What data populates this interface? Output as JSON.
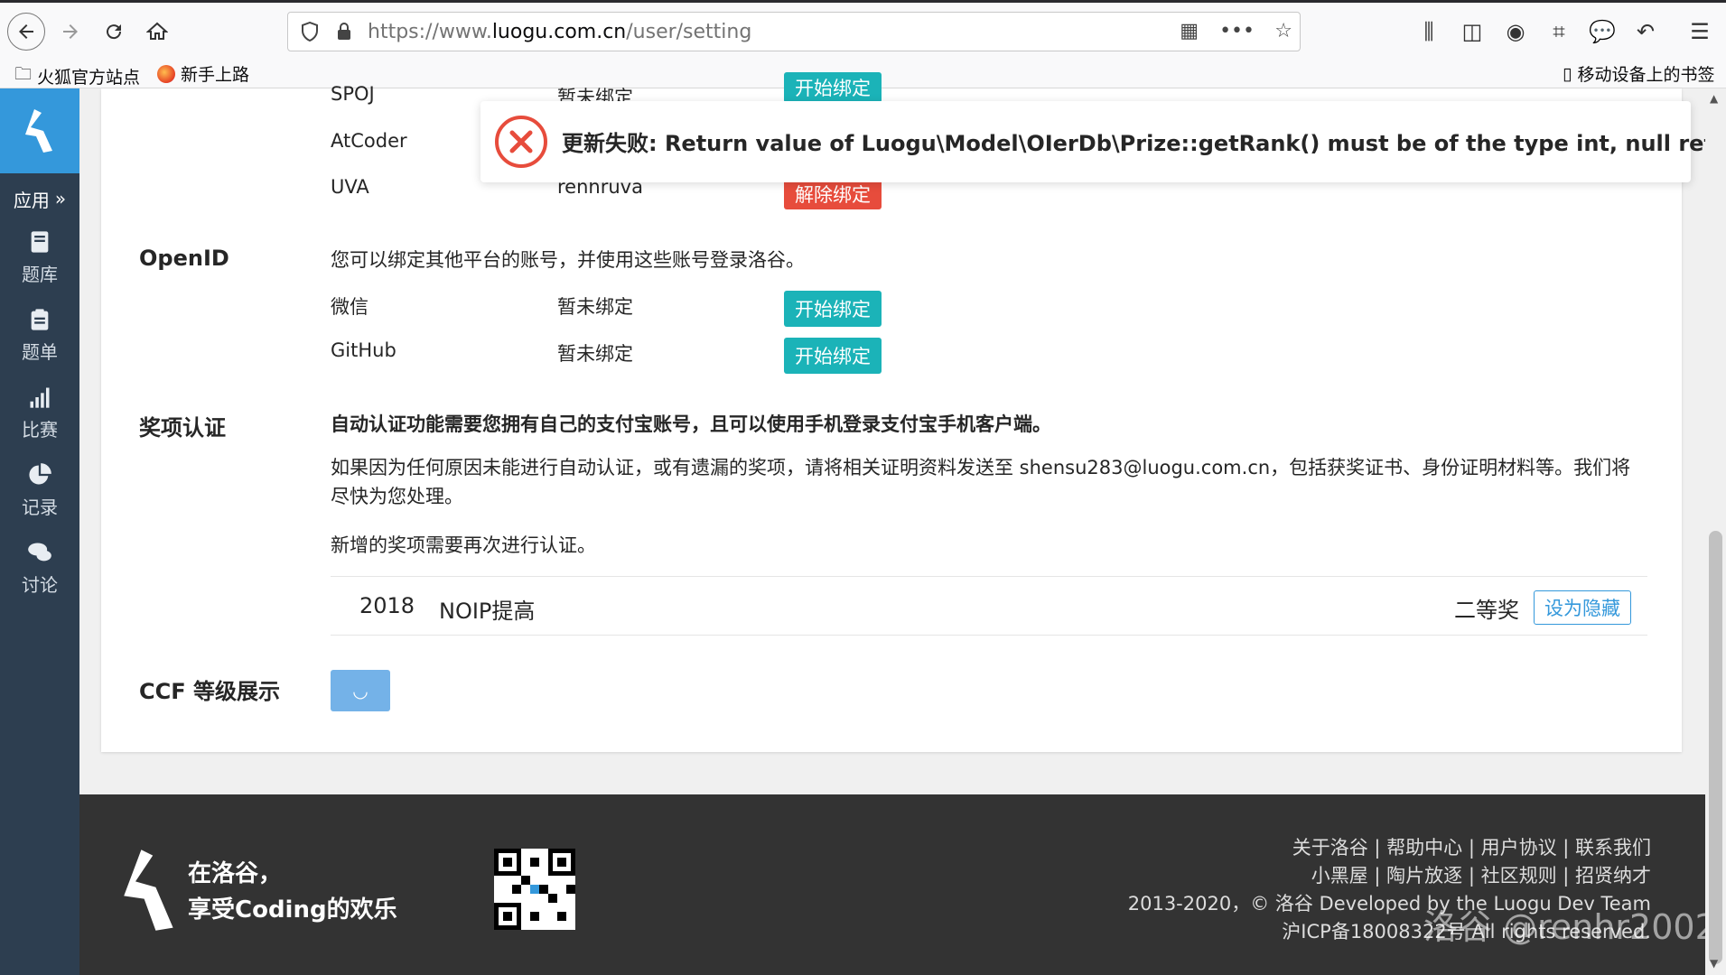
{
  "browser": {
    "url_prefix": "https://www.",
    "url_domain": "luogu.com.cn",
    "url_path": "/user/setting",
    "bookmarks": [
      {
        "label": "火狐官方站点"
      },
      {
        "label": "新手上路"
      }
    ],
    "mobile_bookmarks": "移动设备上的书签"
  },
  "rail": {
    "apps_label": "应用",
    "items": [
      {
        "label": "题库",
        "icon": "book-icon"
      },
      {
        "label": "题单",
        "icon": "clipboard-icon"
      },
      {
        "label": "比赛",
        "icon": "bar-chart-icon"
      },
      {
        "label": "记录",
        "icon": "pie-chart-icon"
      },
      {
        "label": "讨论",
        "icon": "chat-icon"
      }
    ]
  },
  "bindings": {
    "rows": [
      {
        "platform": "SPOJ",
        "status": "暂未绑定",
        "action": "开始绑定"
      },
      {
        "platform": "AtCoder",
        "status": "",
        "action": ""
      },
      {
        "platform": "UVA",
        "status": "renhruva",
        "action": "解除绑定"
      }
    ]
  },
  "openid": {
    "label": "OpenID",
    "desc": "您可以绑定其他平台的账号，并使用这些账号登录洛谷。",
    "rows": [
      {
        "platform": "微信",
        "status": "暂未绑定",
        "action": "开始绑定"
      },
      {
        "platform": "GitHub",
        "status": "暂未绑定",
        "action": "开始绑定"
      }
    ]
  },
  "prize": {
    "label": "奖项认证",
    "bold_desc": "自动认证功能需要您拥有自己的支付宝账号，且可以使用手机登录支付宝手机客户端。",
    "desc": "如果因为任何原因未能进行自动认证，或有遗漏的奖项，请将相关证明资料发送至 shensu283@luogu.com.cn，包括获奖证书、身份证明材料等。我们将尽快为您处理。",
    "note": "新增的奖项需要再次进行认证。",
    "item": {
      "year": "2018",
      "contest": "NOIP提高",
      "award": "二等奖",
      "action": "设为隐藏"
    }
  },
  "ccf": {
    "label": "CCF 等级展示",
    "loading_glyph": "◡"
  },
  "toast": {
    "message": "更新失败: Return value of Luogu\\Model\\OIerDb\\Prize::getRank() must be of the type int, null returned"
  },
  "footer": {
    "slogan_line1": "在洛谷，",
    "slogan_line2": "享受Coding的欢乐",
    "links_line1": "关于洛谷 | 帮助中心 | 用户协议 | 联系我们",
    "links_line2": "小黑屋 | 陶片放逐 | 社区规则 | 招贤纳才",
    "copyright": "2013-2020，© 洛谷 Developed by the Luogu Dev Team",
    "icp": "沪ICP备18008322号 All rights reserved."
  },
  "watermark": "洛谷 @renhr2002",
  "colors": {
    "rail_bg": "#2d3e50",
    "accent_blue": "#3498db",
    "teal_button": "#1bb3b8",
    "red_button": "#e74c3c",
    "error_red": "#e74c3c",
    "footer_bg": "#333333"
  }
}
